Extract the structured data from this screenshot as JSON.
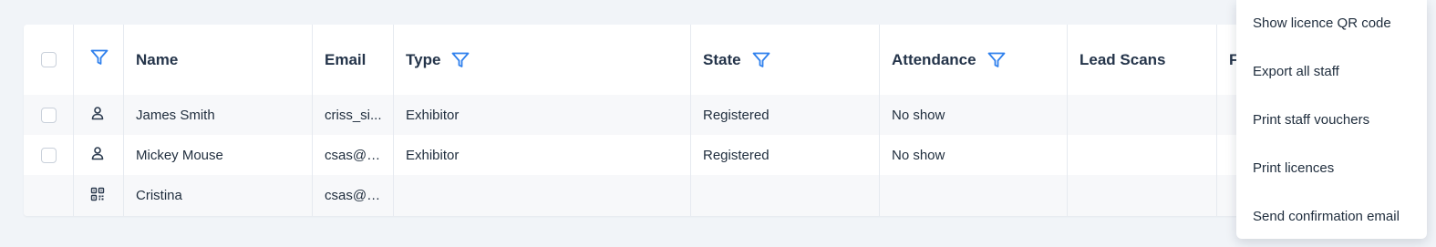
{
  "columns": {
    "name": "Name",
    "email": "Email",
    "type": "Type",
    "state": "State",
    "attendance": "Attendance",
    "lead_scans": "Lead Scans",
    "last_partial": "F"
  },
  "rows": [
    {
      "icon": "person-icon",
      "name": "James Smith",
      "email": "criss_si...",
      "type": "Exhibitor",
      "state": "Registered",
      "attendance": "No show",
      "lead_scans": ""
    },
    {
      "icon": "person-icon",
      "name": "Mickey Mouse",
      "email": "csas@g...",
      "type": "Exhibitor",
      "state": "Registered",
      "attendance": "No show",
      "lead_scans": ""
    },
    {
      "icon": "qr-code-icon",
      "name": "Cristina",
      "email": "csas@g...",
      "type": "",
      "state": "",
      "attendance": "",
      "lead_scans": ""
    }
  ],
  "menu": {
    "items": [
      "Show licence QR code",
      "Export all staff",
      "Print staff vouchers",
      "Print licences",
      "Send confirmation email"
    ]
  },
  "colors": {
    "accent": "#2f80ed",
    "text": "#1f2d3d",
    "row_alt": "#f7f8fa",
    "page_bg": "#f1f4f8"
  }
}
